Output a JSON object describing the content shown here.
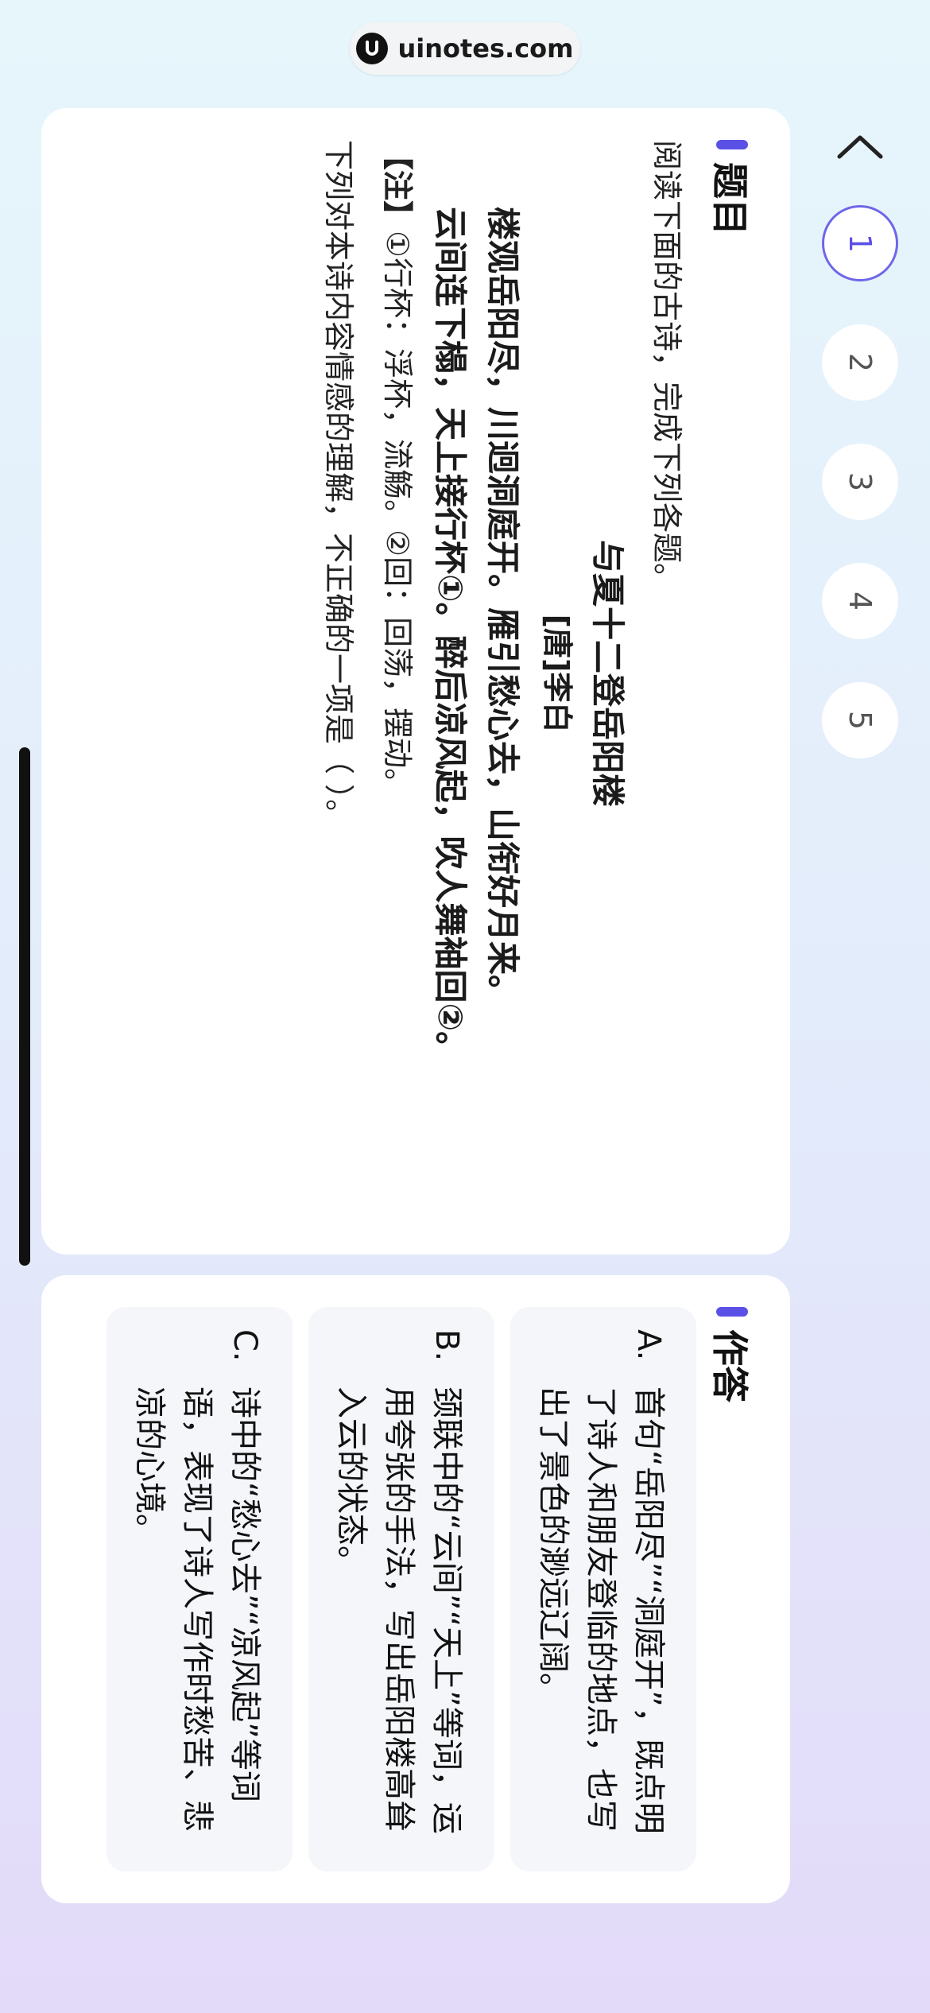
{
  "watermark": {
    "text": "uinotes.com"
  },
  "question_card": {
    "title": "题目",
    "intro": "阅读下面的古诗，完成下列各题。",
    "poem_title": "与夏十二登岳阳楼",
    "poem_author": "[唐]李白",
    "poem_lines": [
      "楼观岳阳尽，川迥洞庭开。雁引愁心去，山衔好月来。",
      "云间连下榻，天上接行杯①。醉后凉风起，吹人舞袖回②。"
    ],
    "note_label": "【注】",
    "note_text": "①行杯：浮杯，流觞。②回：回荡，摆动。",
    "question": "下列对本诗内容情感的理解，不正确的一项是（  ）。"
  },
  "answer_card": {
    "title": "作答",
    "options": [
      {
        "letter": "A.",
        "text": "首句“岳阳尽”“洞庭开”，既点明了诗人和朋友登临的地点，也写出了景色的渺远辽阔。"
      },
      {
        "letter": "B.",
        "text": "颈联中的“云间”“天上”等词，运用夸张的手法，写出岳阳楼高耸入云的状态。"
      },
      {
        "letter": "C.",
        "text": "诗中的“愁心去”“凉风起”等词语，表现了诗人写作时愁苦、悲凉的心境。"
      }
    ]
  },
  "navigation": {
    "questions": [
      "1",
      "2",
      "3",
      "4",
      "5"
    ],
    "active_index": 0
  },
  "colors": {
    "accent": "#5b50e6",
    "card": "#ffffff",
    "option_bg": "#f4f6fa"
  }
}
